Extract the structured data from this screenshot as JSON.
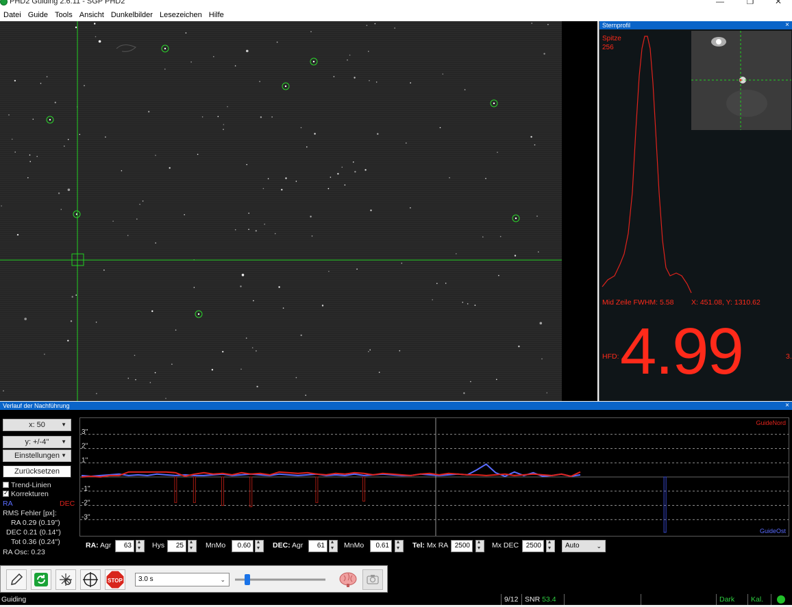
{
  "window": {
    "title": "PHD2 Guiding 2.6.11 - SGP PHD2",
    "minimize": "—",
    "maximize": "❐",
    "close": "✕"
  },
  "menu": [
    "Datei",
    "Guide",
    "Tools",
    "Ansicht",
    "Dunkelbilder",
    "Lesezeichen",
    "Hilfe"
  ],
  "profile": {
    "title": "Sternprofil",
    "close": "×",
    "peak_label": "Spitze",
    "peak_value": "256",
    "fwhm_text": "Mid Zeile FWHM: 5.58",
    "coords_text": "X: 451.08, Y: 1310.62",
    "hfd_label": "HFD:",
    "hfd_value": "4.99",
    "hfd_suffix": "3."
  },
  "history": {
    "title": "Verlauf der Nachführung",
    "close": "×",
    "x_button": "x: 50",
    "y_button": "y: +/-4''",
    "settings_button": "Einstellungen",
    "reset_button": "Zurücksetzen",
    "trend_lines_label": "Trend-Linien",
    "trend_lines_checked": false,
    "corrections_label": "Korrekturen",
    "corrections_checked": true,
    "ra_legend": "RA",
    "dec_legend": "DEC",
    "rms_title": "RMS Fehler [px]:",
    "rms_ra": "RA 0.29 (0.19'')",
    "rms_dec": "DEC 0.21 (0.14'')",
    "rms_tot": "Tot 0.36 (0.24'')",
    "ra_osc": "RA Osc: 0.23",
    "guide_north": "GuideNord",
    "guide_east": "GuideOst",
    "ra_color": "#5a6cff",
    "dec_color": "#e0231c"
  },
  "chart_data": {
    "type": "line",
    "y_ticks": [
      "3''",
      "2''",
      "1''",
      "-1''",
      "-2''",
      "-3''"
    ],
    "ylim": [
      -4,
      4
    ],
    "series": [
      {
        "name": "RA",
        "color": "#5a6cff",
        "values": [
          0.1,
          0.05,
          0.1,
          0.15,
          0.2,
          0.1,
          0.15,
          0.1,
          0.2,
          0.15,
          0.1,
          0.15,
          0.1,
          0.1,
          0.15,
          0.2,
          0.1,
          0.15,
          0.2,
          0.15,
          0.1,
          0.2,
          0.15,
          0.1,
          0.15,
          0.2,
          0.1,
          0.15,
          0.1,
          0.2,
          0.1,
          0.15,
          0.2,
          0.15,
          0.1,
          0.1,
          0.2,
          0.15,
          0.1,
          0.15,
          0.2,
          0.15,
          0.5,
          0.9,
          0.3,
          0.05,
          0.35,
          0.1,
          0.3,
          0.05,
          0.1,
          0.2,
          0.05,
          0.15
        ]
      },
      {
        "name": "DEC",
        "color": "#e0231c",
        "values": [
          0,
          0.05,
          0,
          0.1,
          0.1,
          0.35,
          0.35,
          0.35,
          0.35,
          0.35,
          0.3,
          0.05,
          0.2,
          0.3,
          0.2,
          0.25,
          0.15,
          0.3,
          0.2,
          0.25,
          0.15,
          0.35,
          0.3,
          0.25,
          0.3,
          0.2,
          0.15,
          0.25,
          0.2,
          0.3,
          0.25,
          0.15,
          0.25,
          0.2,
          0.15,
          0.1,
          0.2,
          0.25,
          0.15,
          0.25,
          0.2,
          0.15,
          0.15,
          0.1,
          0.15,
          0.2,
          0.1,
          0.15,
          0.2,
          0.15,
          0.1,
          0.2,
          0.05,
          0.35
        ]
      }
    ],
    "dec_corrections": [
      {
        "index": 10,
        "value": -1.8
      },
      {
        "index": 12,
        "value": -1.8
      },
      {
        "index": 15,
        "value": -2.0
      },
      {
        "index": 18,
        "value": -2.1
      },
      {
        "index": 25,
        "value": -1.8
      },
      {
        "index": 30,
        "value": -1.7
      }
    ],
    "ra_corrections": [
      {
        "index": 62,
        "value": -3.9
      }
    ]
  },
  "params": {
    "ra_label": "RA:",
    "agr_label": "Agr",
    "ra_agr": "63",
    "hys_label": "Hys",
    "ra_hys": "25",
    "mnmo_label": "MnMo",
    "ra_mnmo": "0.60",
    "dec_label": "DEC:",
    "dec_agr": "61",
    "dec_mnmo": "0.61",
    "tel_label": "Tel:",
    "mxra_label": "Mx RA",
    "mx_ra": "2500",
    "mxdec_label": "Mx DEC",
    "mx_dec": "2500",
    "dec_mode": "Auto"
  },
  "toolbar": {
    "exposure": "3.0 s",
    "stop_label": "STOP"
  },
  "status": {
    "left": "Guiding",
    "frame": "9/12",
    "snr_label": "SNR",
    "snr_value": "53.4",
    "dark": "Dark",
    "cal": "Kal.",
    "snr_color": "#2ecc40",
    "ok_color": "#22c02a"
  }
}
